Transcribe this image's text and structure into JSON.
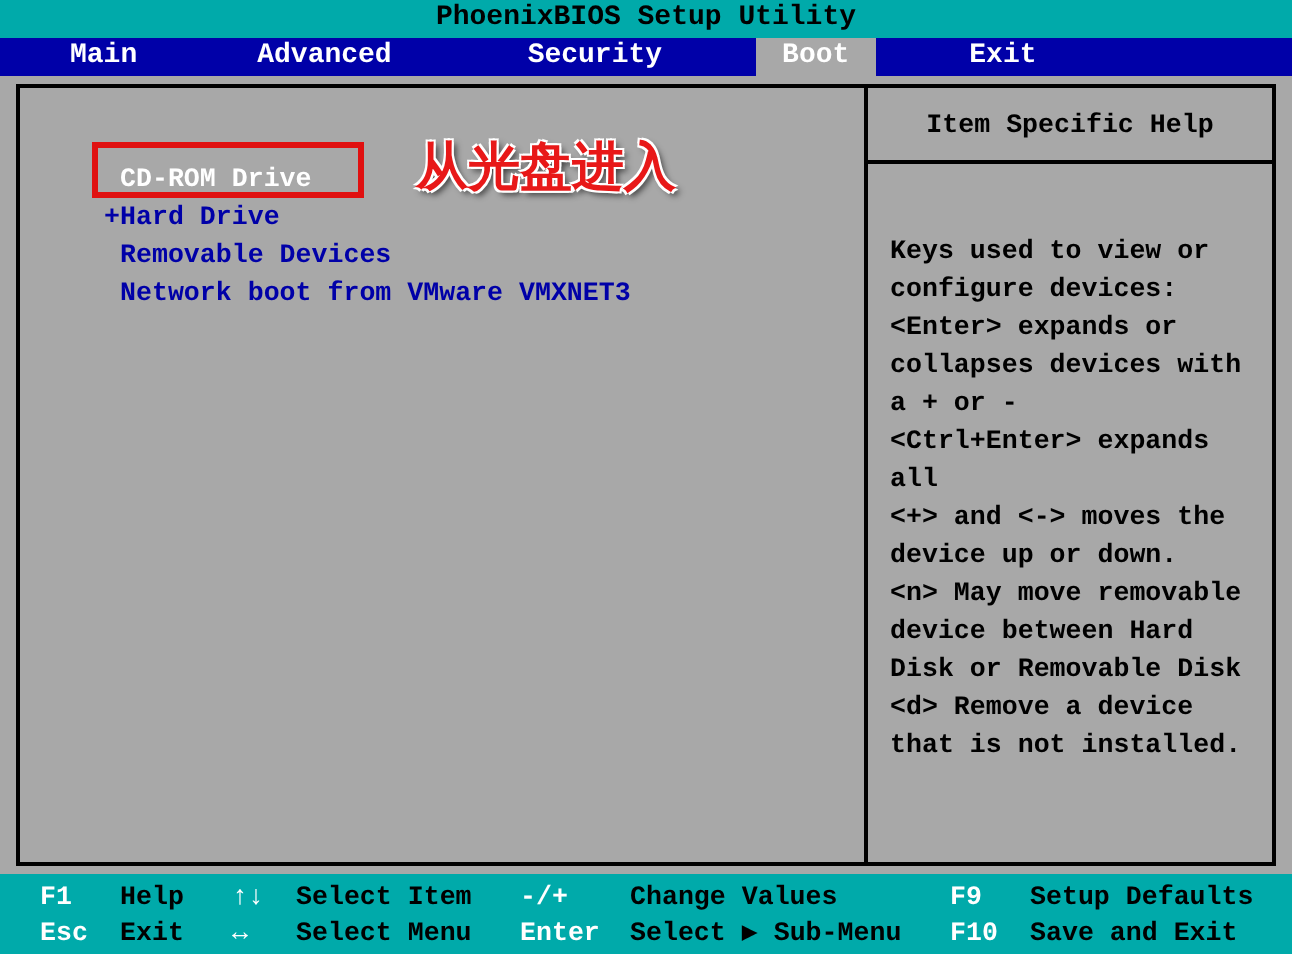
{
  "window": {
    "title": "PhoenixBIOS Setup Utility"
  },
  "tabs": [
    {
      "label": "Main",
      "selected": false
    },
    {
      "label": "Advanced",
      "selected": false
    },
    {
      "label": "Security",
      "selected": false
    },
    {
      "label": "Boot",
      "selected": true
    },
    {
      "label": "Exit",
      "selected": false
    }
  ],
  "boot_items": [
    {
      "label": "CD-ROM Drive",
      "selected": true
    },
    {
      "label": "Hard Drive",
      "selected": false,
      "expander": "+"
    },
    {
      "label": "Removable Devices",
      "selected": false
    },
    {
      "label": "Network boot from VMware VMXNET3",
      "selected": false
    }
  ],
  "annotation": {
    "text": "从光盘进入"
  },
  "help": {
    "title": "Item Specific Help",
    "lines": [
      "Keys used to view or",
      "configure devices:",
      "<Enter> expands or",
      "collapses devices with",
      "a + or -",
      "<Ctrl+Enter> expands",
      "all",
      "<+> and <-> moves the",
      "device up or down.",
      "<n> May move removable",
      "device between Hard",
      "Disk or Removable Disk",
      "<d> Remove a device",
      "that is not installed."
    ]
  },
  "footer": [
    [
      {
        "key": "F1",
        "action": "Help"
      },
      {
        "key": "↑↓",
        "action": "Select Item"
      },
      {
        "key": "-/+",
        "action": "Change Values"
      },
      {
        "key": "F9",
        "action": "Setup Defaults"
      }
    ],
    [
      {
        "key": "Esc",
        "action": "Exit"
      },
      {
        "key": "↔",
        "action": "Select Menu"
      },
      {
        "key": "Enter",
        "action": "Select ▶ Sub-Menu"
      },
      {
        "key": "F10",
        "action": "Save and Exit"
      }
    ]
  ]
}
